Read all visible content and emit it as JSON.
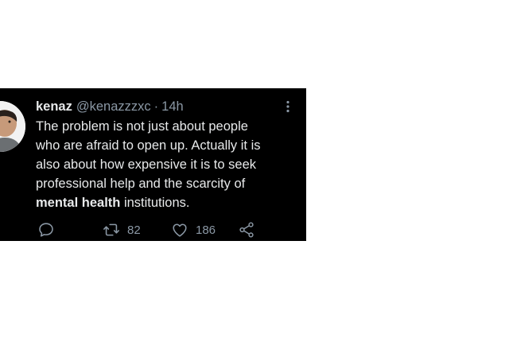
{
  "tweet": {
    "display_name": "kenaz",
    "handle": "@kenazzzxc",
    "separator": "·",
    "time": "14h",
    "text_lines": [
      "The problem is not just about people",
      "who are afraid to open up. Actually it is",
      "also about how expensive it is to seek",
      "professional help and the scarcity of"
    ],
    "text_bold": "mental health",
    "text_end": " institutions.",
    "retweet_count": "82",
    "like_count": "186"
  },
  "icons": {
    "avatar": "avatar-photo",
    "more": "more-icon",
    "reply": "reply-icon",
    "retweet": "retweet-icon",
    "like": "heart-icon",
    "share": "share-icon"
  },
  "colors": {
    "background": "#000000",
    "text": "#e7e9ea",
    "secondary": "#8b98a5"
  }
}
